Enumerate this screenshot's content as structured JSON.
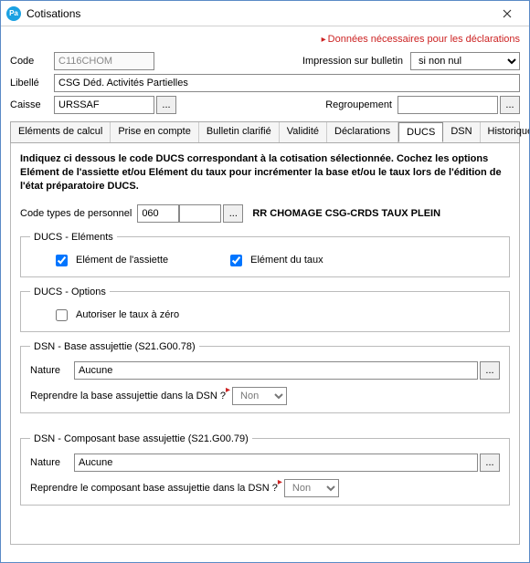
{
  "window": {
    "title": "Cotisations"
  },
  "header": {
    "decl_link": "Données nécessaires pour les déclarations",
    "code_label": "Code",
    "code_value": "C116CHOM",
    "impr_label": "Impression sur bulletin",
    "impr_value": "si non nul",
    "libelle_label": "Libellé",
    "libelle_value": "CSG Déd. Activités Partielles",
    "caisse_label": "Caisse",
    "caisse_value": "URSSAF",
    "regroup_label": "Regroupement",
    "regroup_value": "",
    "ellipsis": "..."
  },
  "tabs": {
    "items": [
      "Eléments de calcul",
      "Prise en compte",
      "Bulletin clarifié",
      "Validité",
      "Déclarations",
      "DUCS",
      "DSN",
      "Historiques"
    ],
    "active_index": 5
  },
  "ducs": {
    "instruction": "Indiquez ci dessous le code DUCS correspondant à la cotisation sélectionnée. Cochez les options Elément de l'assiette et/ou Elément du taux pour incrémenter la base et/ou le taux lors de l'édition de l'état préparatoire DUCS.",
    "code_types_label": "Code types de personnel",
    "code_types_value": "060",
    "code_types_desc": "RR CHOMAGE CSG-CRDS TAUX PLEIN",
    "elements_legend": "DUCS - Eléments",
    "chk_assiette": "Elément de l'assiette",
    "chk_taux": "Elément du taux",
    "options_legend": "DUCS - Options",
    "chk_zero": "Autoriser le taux à zéro"
  },
  "dsn78": {
    "legend": "DSN - Base assujettie (S21.G00.78)",
    "nature_label": "Nature",
    "nature_value": "Aucune",
    "question": "Reprendre la base assujettie dans la DSN ?",
    "answer": "Non"
  },
  "dsn79": {
    "legend": "DSN - Composant base assujettie (S21.G00.79)",
    "nature_label": "Nature",
    "nature_value": "Aucune",
    "question": "Reprendre le composant base assujettie dans la DSN ?",
    "answer": "Non"
  }
}
